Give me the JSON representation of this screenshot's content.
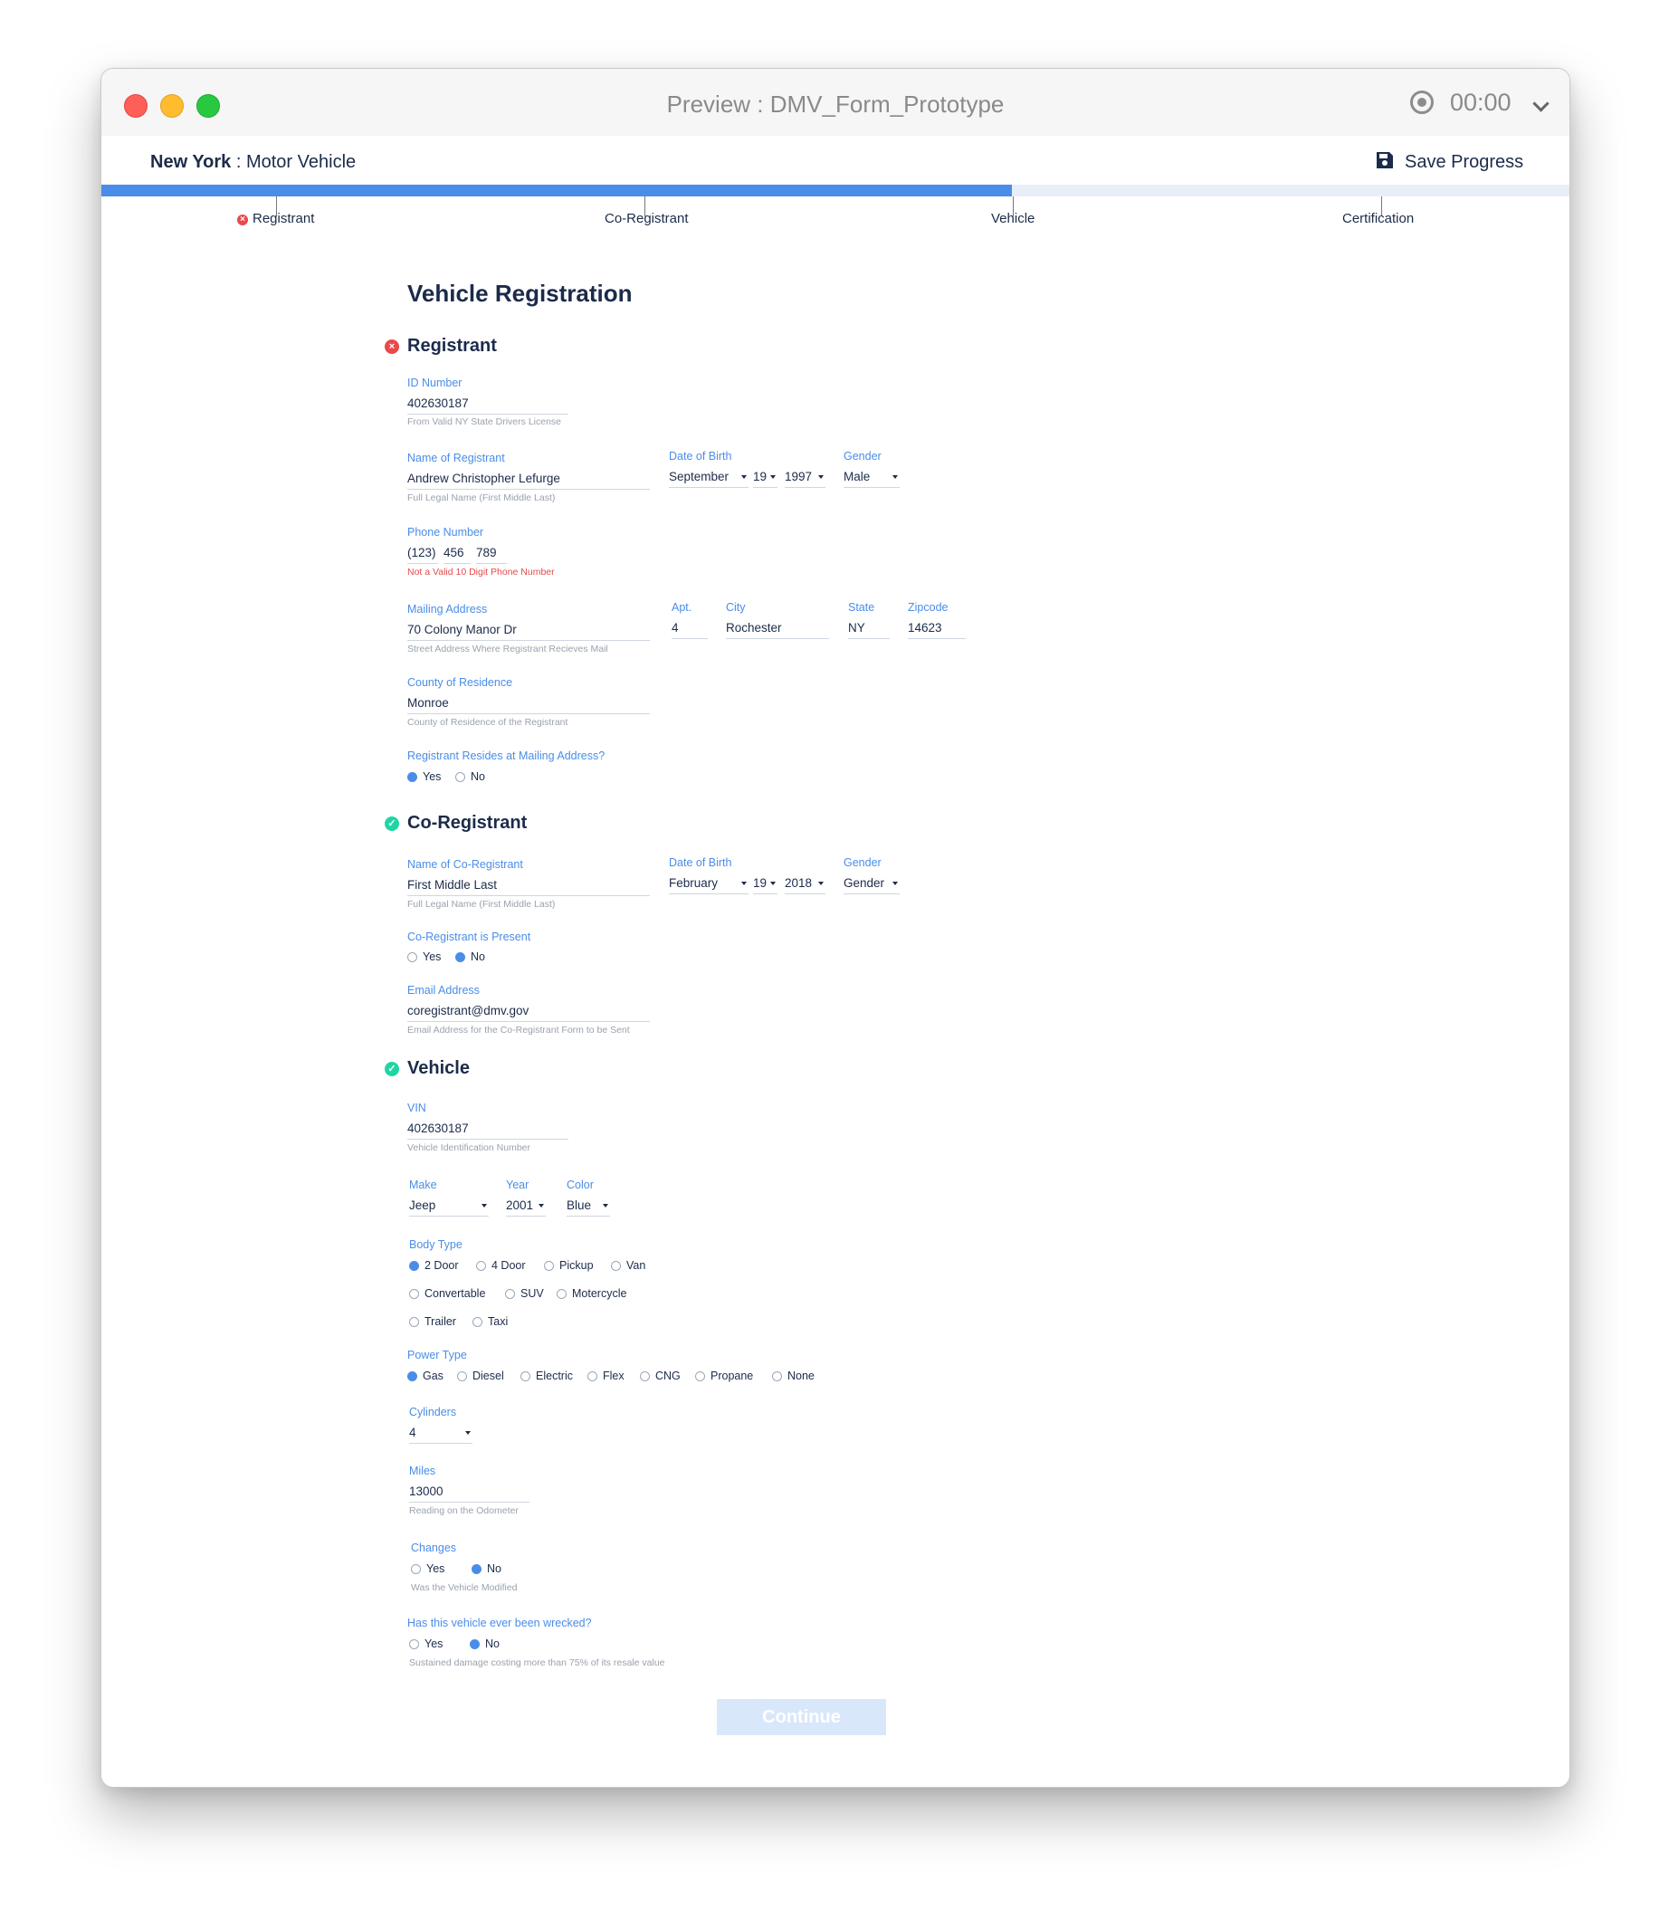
{
  "window": {
    "title": "Preview : DMV_Form_Prototype",
    "timer": "00:00"
  },
  "app": {
    "brand_state": "New York",
    "brand_sep": " : ",
    "brand_name": "Motor Vehicle",
    "save_label": "Save Progress"
  },
  "progress": {
    "fraction": 0.62,
    "steps": [
      "Registrant",
      "Co-Registrant",
      "Vehicle",
      "Certification"
    ]
  },
  "form": {
    "title": "Vehicle Registration",
    "registrant": {
      "heading": "Registrant",
      "id_label": "ID Number",
      "id_value": "402630187",
      "id_hint": "From Valid NY State Drivers License",
      "name_label": "Name of Registrant",
      "name_value": "Andrew Christopher Lefurge",
      "name_hint": "Full Legal Name (First Middle Last)",
      "dob_label": "Date of Birth",
      "dob_month": "September",
      "dob_day": "19",
      "dob_year": "1997",
      "gender_label": "Gender",
      "gender_value": "Male",
      "phone_label": "Phone Number",
      "phone_area": "(123)",
      "phone_prefix": "456",
      "phone_line": "789",
      "phone_error": "Not a Valid 10 Digit Phone Number",
      "addr_label": "Mailing Address",
      "addr_value": "70 Colony Manor Dr",
      "addr_hint": "Street Address Where Registrant Recieves Mail",
      "apt_label": "Apt.",
      "apt_value": "4",
      "city_label": "City",
      "city_value": "Rochester",
      "state_label": "State",
      "state_value": "NY",
      "zip_label": "Zipcode",
      "zip_value": "14623",
      "county_label": "County of Residence",
      "county_value": "Monroe",
      "county_hint": "County of Residence of the Registrant",
      "resides_label": "Registrant Resides at Mailing Address?",
      "yes": "Yes",
      "no": "No"
    },
    "coregistrant": {
      "heading": "Co-Registrant",
      "name_label": "Name of Co-Registrant",
      "name_value": "First Middle Last",
      "name_hint": "Full Legal Name (First Middle Last)",
      "dob_label": "Date of Birth",
      "dob_month": "February",
      "dob_day": "19",
      "dob_year": "2018",
      "gender_label": "Gender",
      "gender_value": "Gender",
      "present_label": "Co-Registrant is Present",
      "yes": "Yes",
      "no": "No",
      "email_label": "Email Address",
      "email_value": "coregistrant@dmv.gov",
      "email_hint": "Email Address for the Co-Registrant Form to be Sent"
    },
    "vehicle": {
      "heading": "Vehicle",
      "vin_label": "VIN",
      "vin_value": "402630187",
      "vin_hint": "Vehicle Identification Number",
      "make_label": "Make",
      "make_value": "Jeep",
      "year_label": "Year",
      "year_value": "2001",
      "color_label": "Color",
      "color_value": "Blue",
      "body_label": "Body Type",
      "body_options": [
        "2 Door",
        "4 Door",
        "Pickup",
        "Van",
        "Convertable",
        "SUV",
        "Motercycle",
        "Trailer",
        "Taxi"
      ],
      "power_label": "Power Type",
      "power_options": [
        "Gas",
        "Diesel",
        "Electric",
        "Flex",
        "CNG",
        "Propane",
        "None"
      ],
      "cyl_label": "Cylinders",
      "cyl_value": "4",
      "miles_label": "Miles",
      "miles_value": "13000",
      "miles_hint": "Reading on the Odometer",
      "changes_label": "Changes",
      "changes_hint": "Was the Vehicle Modified",
      "wrecked_label": "Has this vehicle ever been wrecked?",
      "wrecked_hint": "Sustained damage costing more than 75% of its resale value",
      "yes": "Yes",
      "no": "No"
    },
    "continue_label": "Continue"
  },
  "colors": {
    "accent": "#4a8de8",
    "navy": "#1c2b4a",
    "error": "#e8494b",
    "ok": "#1fd6a3",
    "button_disabled": "#d9e7fb"
  }
}
